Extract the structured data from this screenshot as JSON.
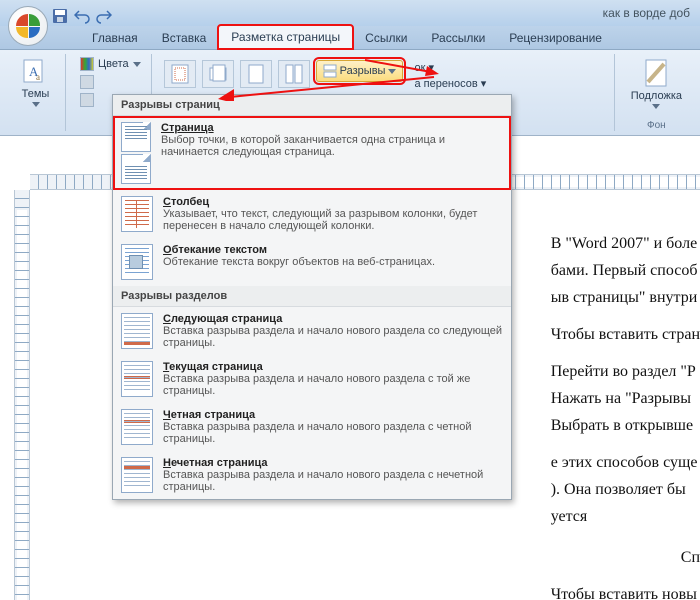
{
  "title": "как в ворде доб",
  "tabs": {
    "home": "Главная",
    "insert": "Вставка",
    "layout": "Разметка страницы",
    "references": "Ссылки",
    "mailings": "Рассылки",
    "review": "Рецензирование"
  },
  "ribbon": {
    "themes": "Темы",
    "colors": "Цвета",
    "breaks_btn": "Разрывы",
    "right_visible_1": "ок ▾",
    "right_visible_2": "а переносов ▾",
    "watermark": "Подложка",
    "label_background": "Фон"
  },
  "dropdown": {
    "section_page_breaks": "Разрывы страниц",
    "page": {
      "title": "Страница",
      "desc": "Выбор точки, в которой заканчивается одна страница и начинается следующая страница."
    },
    "column": {
      "title": "Столбец",
      "desc": "Указывает, что текст, следующий за разрывом колонки, будет перенесен в начало следующей колонки."
    },
    "textwrap": {
      "title": "Обтекание текстом",
      "desc": "Обтекание текста вокруг объектов на веб-страницах."
    },
    "section_section_breaks": "Разрывы разделов",
    "nextpage": {
      "title": "Следующая страница",
      "desc": "Вставка разрыва раздела и начало нового раздела со следующей страницы."
    },
    "continuous": {
      "title": "Текущая страница",
      "desc": "Вставка разрыва раздела и начало нового раздела с той же страницы."
    },
    "evenpage": {
      "title": "Четная страница",
      "desc": "Вставка разрыва раздела и начало нового раздела с четной страницы."
    },
    "oddpage": {
      "title": "Нечетная страница",
      "desc": "Вставка разрыва раздела и начало нового раздела с нечетной страницы."
    }
  },
  "doc": {
    "l1": "В \"Word 2007\" и боле",
    "l2": "бами. Первый способ",
    "l3": "ыв страницы\" внутри",
    "l4": "Чтобы вставить стран",
    "l5": "Перейти во раздел \"Р",
    "l6": "Нажать на \"Разрывы",
    "l7": "Выбрать в открывше",
    "l8": "е этих способов суще",
    "l9": ").  Она позволяет бы",
    "l10": "уется",
    "l11": "Сп",
    "l12": "Чтобы вставить новы"
  },
  "colors": {
    "highlight": "#e11111"
  }
}
